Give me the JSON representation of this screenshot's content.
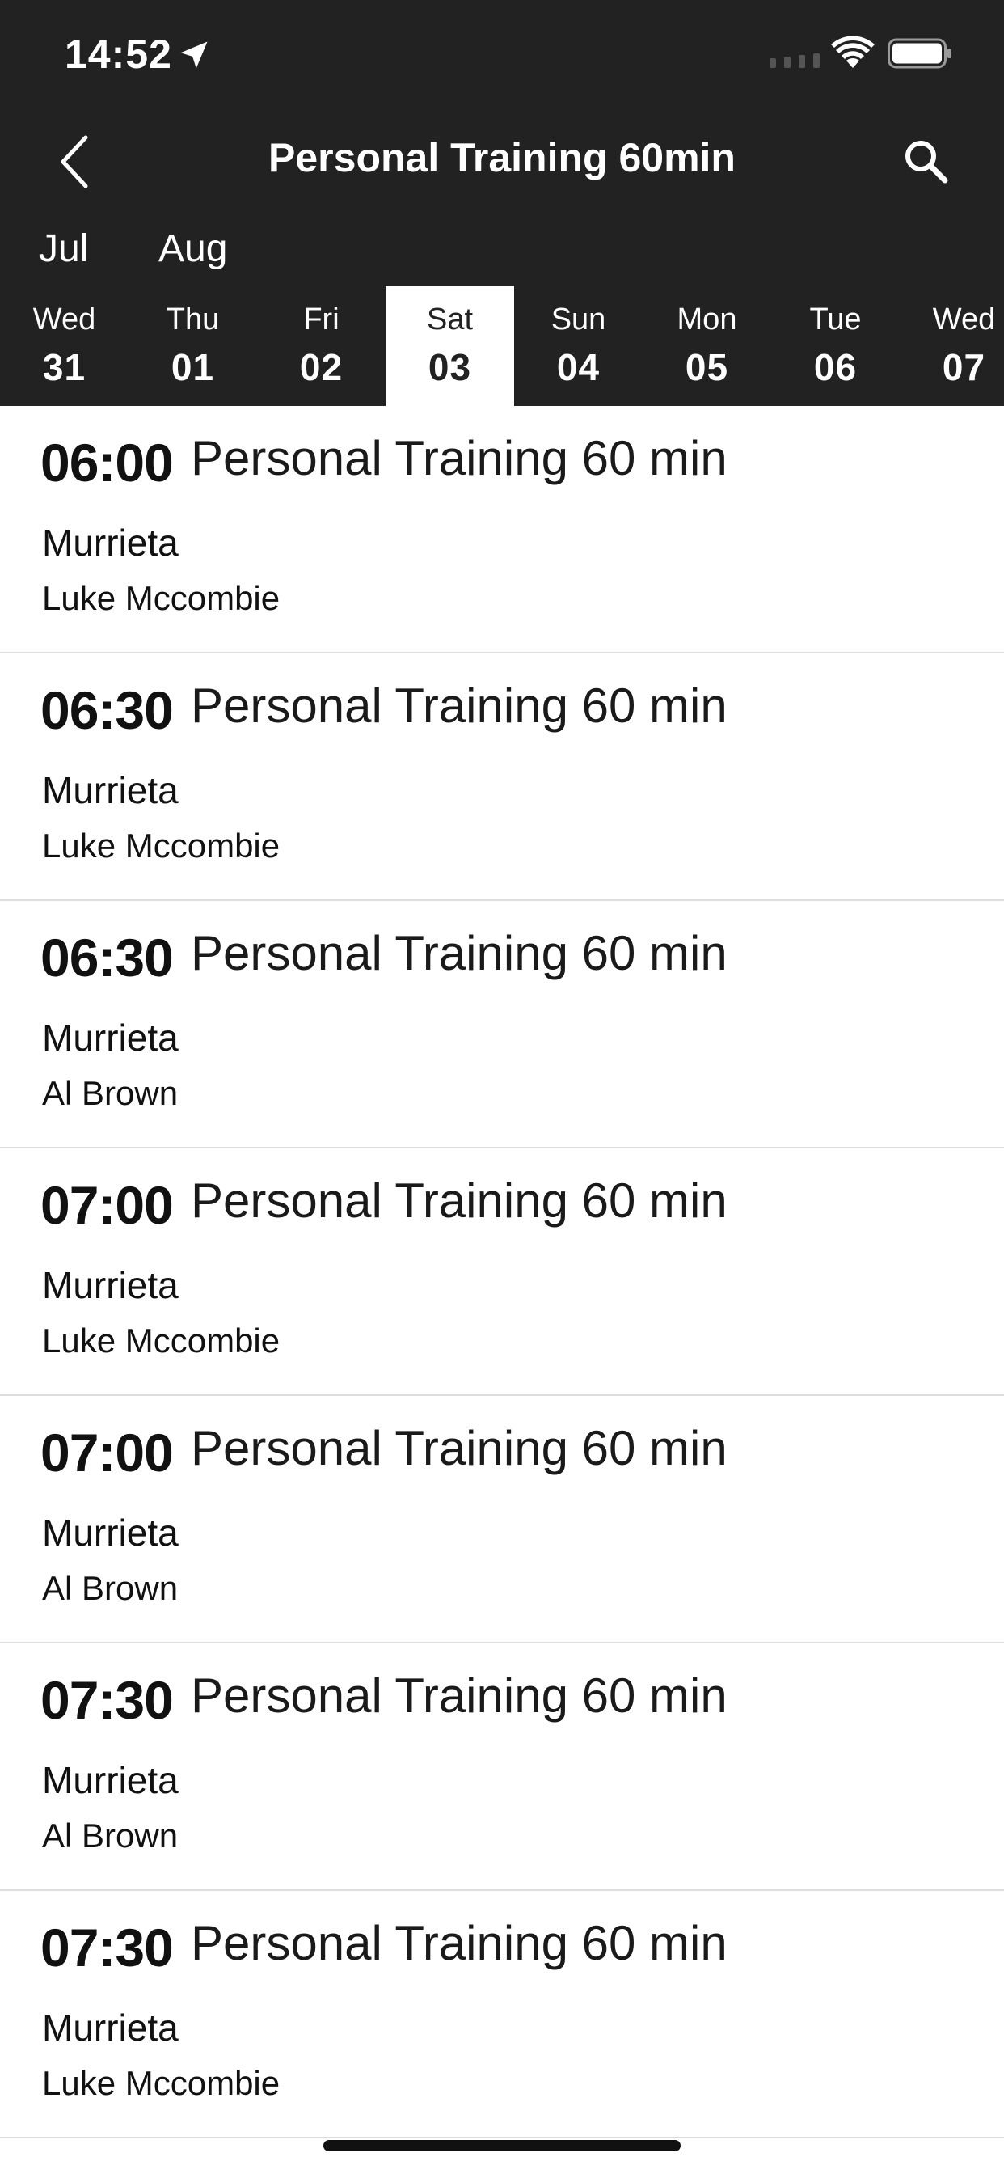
{
  "status_bar": {
    "time": "14:52"
  },
  "nav": {
    "title": "Personal Training 60min",
    "back_icon": "chevron-left-icon",
    "search_icon": "search-icon"
  },
  "months": [
    "Jul",
    "Aug"
  ],
  "days": [
    {
      "name": "Wed",
      "num": "31"
    },
    {
      "name": "Thu",
      "num": "01"
    },
    {
      "name": "Fri",
      "num": "02"
    },
    {
      "name": "Sat",
      "num": "03",
      "selected": true
    },
    {
      "name": "Sun",
      "num": "04"
    },
    {
      "name": "Mon",
      "num": "05"
    },
    {
      "name": "Tue",
      "num": "06"
    },
    {
      "name": "Wed",
      "num": "07"
    }
  ],
  "sessions": [
    {
      "time": "06:00",
      "title": "Personal Training 60 min",
      "location": "Murrieta",
      "trainer": "Luke Mccombie"
    },
    {
      "time": "06:30",
      "title": "Personal Training 60 min",
      "location": "Murrieta",
      "trainer": "Luke Mccombie"
    },
    {
      "time": "06:30",
      "title": "Personal Training 60 min",
      "location": "Murrieta",
      "trainer": "Al Brown"
    },
    {
      "time": "07:00",
      "title": "Personal Training 60 min",
      "location": "Murrieta",
      "trainer": "Luke Mccombie"
    },
    {
      "time": "07:00",
      "title": "Personal Training 60 min",
      "location": "Murrieta",
      "trainer": "Al Brown"
    },
    {
      "time": "07:30",
      "title": "Personal Training 60 min",
      "location": "Murrieta",
      "trainer": "Al Brown"
    },
    {
      "time": "07:30",
      "title": "Personal Training 60 min",
      "location": "Murrieta",
      "trainer": "Luke Mccombie"
    }
  ],
  "colors": {
    "header_bg": "#222222",
    "selected_day_bg": "#ffffff",
    "text_light": "#ffffff",
    "text_dark": "#111111",
    "divider": "#dddddd"
  }
}
